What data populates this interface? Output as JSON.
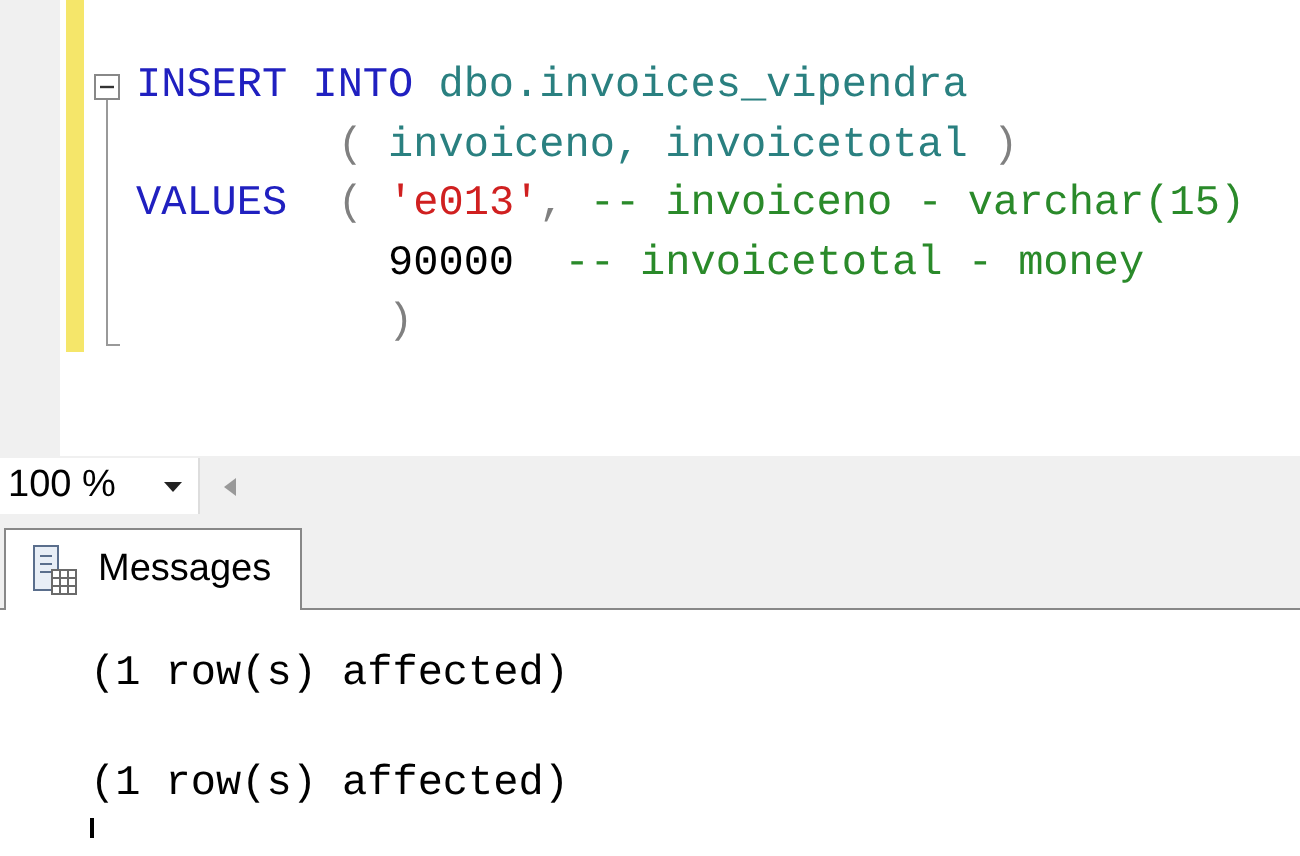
{
  "editor": {
    "lines": [
      {
        "collapsible": true,
        "tokens": [
          {
            "text": "INSERT INTO",
            "kind": "keyword"
          },
          {
            "text": " dbo.invoices_vipendra",
            "kind": "ident"
          }
        ]
      },
      {
        "collapsible": false,
        "tokens": [
          {
            "text": "        ( ",
            "kind": "punct"
          },
          {
            "text": "invoiceno, invoicetotal",
            "kind": "ident"
          },
          {
            "text": " )",
            "kind": "punct"
          }
        ]
      },
      {
        "collapsible": false,
        "tokens": [
          {
            "text": "VALUES",
            "kind": "keyword"
          },
          {
            "text": "  ( ",
            "kind": "punct"
          },
          {
            "text": "'e013'",
            "kind": "string"
          },
          {
            "text": ", ",
            "kind": "punct"
          },
          {
            "text": "-- invoiceno - varchar(15)",
            "kind": "comment"
          }
        ]
      },
      {
        "collapsible": false,
        "tokens": [
          {
            "text": "          90000",
            "kind": "plain"
          },
          {
            "text": "  -- invoicetotal - money",
            "kind": "comment"
          }
        ]
      },
      {
        "collapsible": false,
        "tokens": [
          {
            "text": "          )",
            "kind": "punct"
          }
        ]
      }
    ]
  },
  "zoom": {
    "value": "100 %"
  },
  "results": {
    "tabs": [
      {
        "label": "Messages",
        "selected": true
      }
    ],
    "messages": [
      "(1 row(s) affected)",
      "(1 row(s) affected)"
    ]
  }
}
